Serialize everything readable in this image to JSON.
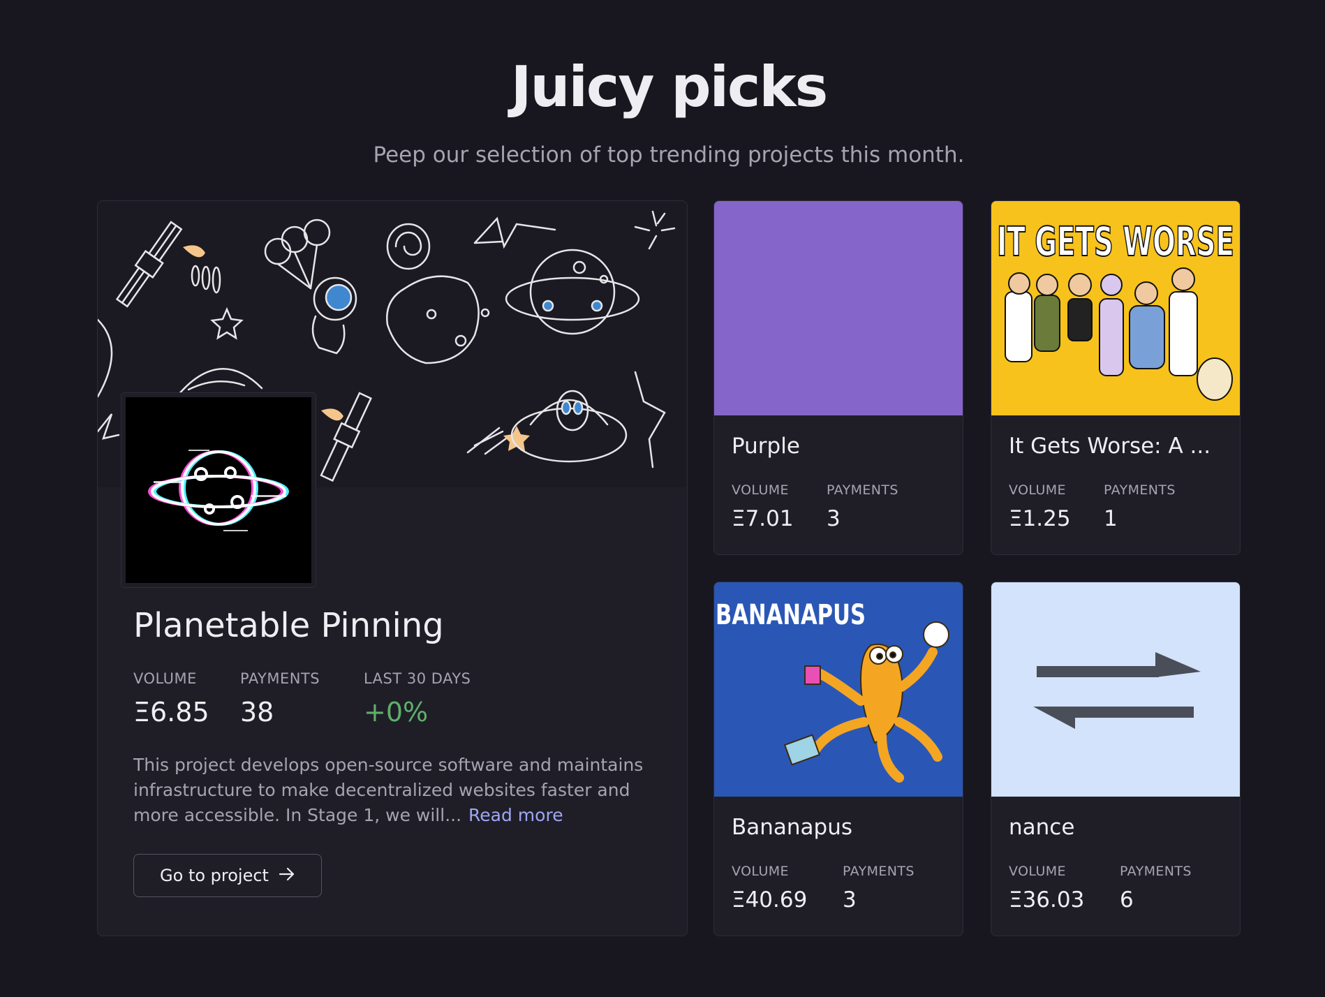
{
  "header": {
    "title": "Juicy picks",
    "subtitle": "Peep our selection of top trending projects this month."
  },
  "featured": {
    "name": "Planetable Pinning",
    "stats": {
      "volume_label": "VOLUME",
      "volume": "Ξ6.85",
      "payments_label": "PAYMENTS",
      "payments": "38",
      "last30_label": "LAST 30 DAYS",
      "last30": "+0%"
    },
    "description": "This project develops open-source software and maintains infrastructure to make decentralized websites faster and more accessible. In Stage 1, we will...",
    "read_more": "Read more",
    "button_label": "Go to project",
    "banner_icon": "space-doodles-banner",
    "logo_icon": "glitch-planet-logo"
  },
  "projects": [
    {
      "name": "Purple",
      "volume_label": "VOLUME",
      "volume": "Ξ7.01",
      "payments_label": "PAYMENTS",
      "payments": "3",
      "thumb_color": "#8565c9"
    },
    {
      "name": "It Gets Worse: A ...",
      "volume_label": "VOLUME",
      "volume": "Ξ1.25",
      "payments_label": "PAYMENTS",
      "payments": "1",
      "thumb_color": "#f7c21b",
      "thumb_text": "IT GETS WORSE"
    },
    {
      "name": "Bananapus",
      "volume_label": "VOLUME",
      "volume": "Ξ40.69",
      "payments_label": "PAYMENTS",
      "payments": "3",
      "thumb_color": "#2a57b5",
      "thumb_text": "BANANAPUS"
    },
    {
      "name": "nance",
      "volume_label": "VOLUME",
      "volume": "Ξ36.03",
      "payments_label": "PAYMENTS",
      "payments": "6",
      "thumb_color": "#d2e3fb"
    }
  ]
}
